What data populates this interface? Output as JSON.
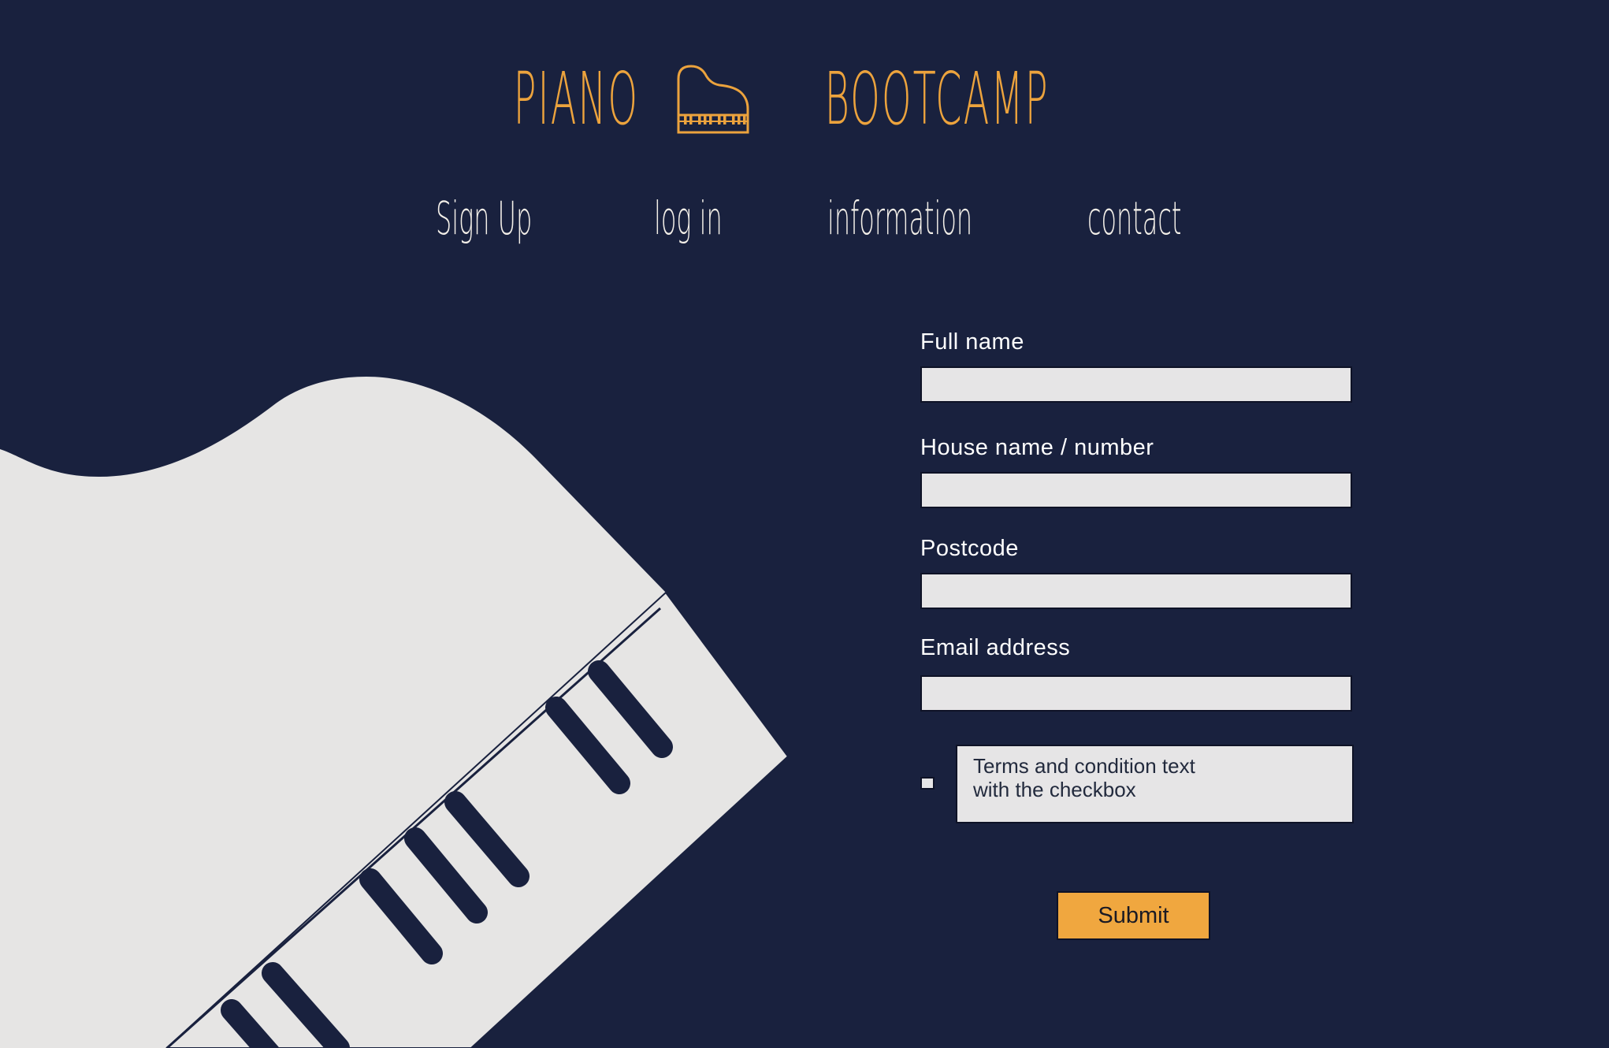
{
  "header": {
    "brand_left": "PIANO",
    "brand_right": "BOOTCAMP",
    "logo_icon": "grand-piano-icon"
  },
  "nav": {
    "items": [
      {
        "label": "Sign Up"
      },
      {
        "label": "log in"
      },
      {
        "label": "information"
      },
      {
        "label": "contact"
      }
    ]
  },
  "form": {
    "full_name_label": "Full name",
    "full_name_value": "",
    "house_label": "House name / number",
    "house_value": "",
    "postcode_label": "Postcode",
    "postcode_value": "",
    "email_label": "Email address",
    "email_value": "",
    "terms_checked": false,
    "terms_line1": "Terms and condition text",
    "terms_line2": "with the checkbox",
    "submit_label": "Submit"
  },
  "colors": {
    "background": "#19213e",
    "accent": "#eca33d",
    "button": "#f0a73f",
    "piano_body": "#e6e5e4",
    "input_fill": "#e6e5e6",
    "nav_text": "#f3efe8"
  }
}
